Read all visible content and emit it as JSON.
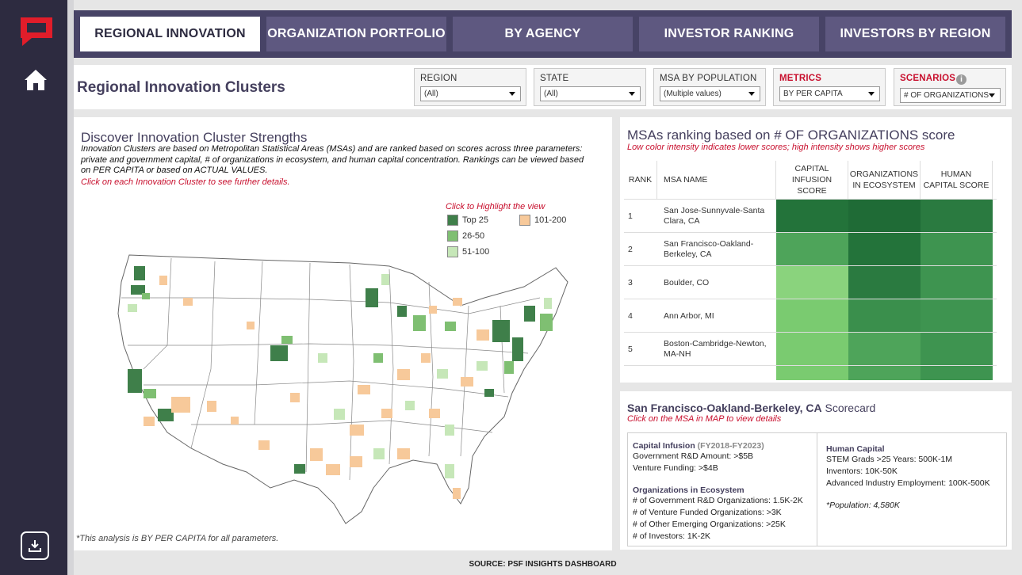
{
  "nav": {
    "tabs": [
      {
        "label": "REGIONAL INNOVATION",
        "active": true
      },
      {
        "label": "ORGANIZATION PORTFOLIO",
        "active": false
      },
      {
        "label": "BY AGENCY",
        "active": false
      },
      {
        "label": "INVESTOR RANKING",
        "active": false
      },
      {
        "label": "INVESTORS BY REGION",
        "active": false
      }
    ]
  },
  "header": {
    "title": "Regional Innovation Clusters",
    "filters": [
      {
        "label": "REGION",
        "value": "(All)"
      },
      {
        "label": "STATE",
        "value": "(All)"
      },
      {
        "label": "MSA BY POPULATION",
        "value": "(Multiple values)"
      },
      {
        "label": "METRICS",
        "value": "BY PER CAPITA"
      },
      {
        "label": "SCENARIOS",
        "value": "# OF ORGANIZATIONS"
      }
    ]
  },
  "map_panel": {
    "title": "Discover Innovation Cluster Strengths",
    "description": "Innovation Clusters are based on Metropolitan Statistical Areas (MSAs) and are ranked based on scores across three parameters: private and government capital, # of organizations in ecosystem, and human capital concentration. Rankings can be viewed based on PER CAPITA or based on ACTUAL VALUES.",
    "link": "Click on each Innovation Cluster to see further details.",
    "legend_hint": "Click to Highlight the view",
    "legend": [
      {
        "label": "Top 25",
        "color": "#3f7f4a"
      },
      {
        "label": "26-50",
        "color": "#7fbf72"
      },
      {
        "label": "51-100",
        "color": "#c6e7b8"
      },
      {
        "label": "101-200",
        "color": "#f7c99a"
      }
    ],
    "footnote": "*This analysis is BY PER CAPITA for all parameters."
  },
  "ranking": {
    "title": "MSAs ranking based on # OF ORGANIZATIONS score",
    "subtitle": "Low color intensity indicates lower scores; high intensity shows higher scores",
    "headers": {
      "rank": "RANK",
      "msa": "MSA NAME",
      "cap": "CAPITAL INFUSION SCORE",
      "org": "ORGANIZATIONS IN ECOSYSTEM",
      "hum": "HUMAN CAPITAL SCORE"
    },
    "rows": [
      {
        "rank": "1",
        "name": "San Jose-Sunnyvale-Santa Clara, CA",
        "colors": [
          "#23733a",
          "#1f6b36",
          "#2a7a40"
        ]
      },
      {
        "rank": "2",
        "name": "San Francisco-Oakland-Berkeley, CA",
        "colors": [
          "#4ea45a",
          "#23733a",
          "#3e9450"
        ]
      },
      {
        "rank": "3",
        "name": "Boulder, CO",
        "colors": [
          "#8ad37d",
          "#2a7a40",
          "#3e9450"
        ]
      },
      {
        "rank": "4",
        "name": "Ann Arbor, MI",
        "colors": [
          "#7acb70",
          "#3a8f4c",
          "#3e9450"
        ]
      },
      {
        "rank": "5",
        "name": "Boston-Cambridge-Newton, MA-NH",
        "colors": [
          "#7acb70",
          "#4ea45a",
          "#3e9450"
        ]
      }
    ]
  },
  "scorecard": {
    "msa": "San Francisco-Oakland-Berkeley, CA",
    "title_suffix": "Scorecard",
    "subtitle": "Click on the MSA in MAP to view details",
    "capital": {
      "heading": "Capital Infusion",
      "period": "(FY2018-FY2023)",
      "lines": [
        "Government R&D Amount: >$5B",
        "Venture Funding: >$4B"
      ]
    },
    "orgs": {
      "heading": "Organizations in Ecosystem",
      "lines": [
        "# of Government R&D Organizations: 1.5K-2K",
        "# of Venture Funded Organizations: >3K",
        "# of Other Emerging Organizations: >25K",
        "# of Investors: 1K-2K"
      ]
    },
    "human": {
      "heading": "Human Capital",
      "lines": [
        "STEM Grads >25 Years: 500K-1M",
        "Inventors: 10K-50K",
        "Advanced Industry Employment: 100K-500K"
      ],
      "population": "*Population: 4,580K"
    }
  },
  "source": "SOURCE: PSF INSIGHTS DASHBOARD"
}
